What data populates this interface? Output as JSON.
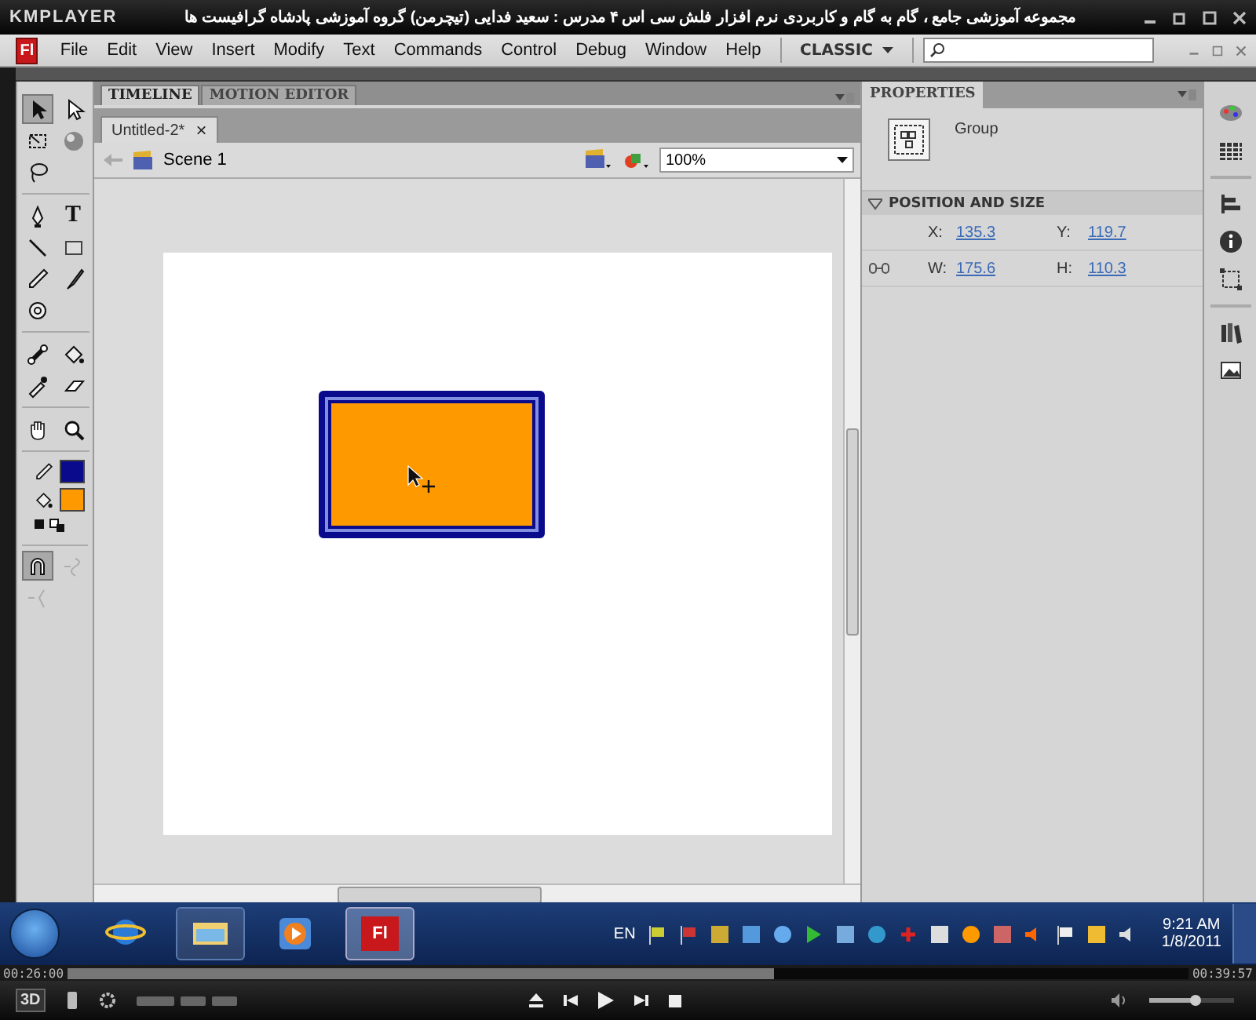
{
  "player": {
    "logo": "KMPLAYER",
    "title": "مجموعه آموزشی جامع ، گام به گام و کاربردی نرم افزار فلش سی اس ۴  مدرس : سعید فدایی (تیچرمن) گروه آموزشی پادشاه گرافیست ها"
  },
  "app": {
    "logo": "Fl",
    "menus": [
      "File",
      "Edit",
      "View",
      "Insert",
      "Modify",
      "Text",
      "Commands",
      "Control",
      "Debug",
      "Window",
      "Help"
    ],
    "workspace": "CLASSIC"
  },
  "panel_tabs": [
    {
      "label": "TIMELINE",
      "selected": true
    },
    {
      "label": "MOTION EDITOR",
      "selected": false
    }
  ],
  "document_tabs": [
    {
      "label": "Untitled-2*",
      "close": "×",
      "selected": true
    }
  ],
  "breadcrumb": "Scene 1",
  "zoom": "100%",
  "tools": [
    {
      "kind": "selection",
      "selected": true
    },
    {
      "kind": "subselection",
      "selected": false
    },
    {
      "kind": "transform",
      "selected": false
    },
    {
      "kind": "rotate3d",
      "selected": false
    },
    {
      "kind": "lasso",
      "selected": false
    },
    {
      "kind": "pen",
      "selected": false
    },
    {
      "kind": "text",
      "label": "T",
      "selected": false
    },
    {
      "kind": "line",
      "selected": false
    },
    {
      "kind": "rectangle",
      "selected": false
    },
    {
      "kind": "pencil",
      "selected": false
    },
    {
      "kind": "brush",
      "selected": false
    },
    {
      "kind": "deco",
      "selected": false
    },
    {
      "kind": "bone",
      "selected": false
    },
    {
      "kind": "bucket",
      "selected": false
    },
    {
      "kind": "eyedropper",
      "selected": false
    },
    {
      "kind": "eraser",
      "selected": false
    },
    {
      "kind": "hand",
      "selected": false
    },
    {
      "kind": "zoom",
      "selected": false
    }
  ],
  "colors": [
    {
      "kind": "stroke",
      "color": "#0a0a8c"
    },
    {
      "kind": "fill",
      "color": "#ff9900"
    }
  ],
  "options": [
    {
      "kind": "snap",
      "selected": true,
      "disabled": false
    },
    {
      "kind": "smooth",
      "selected": false,
      "disabled": true
    },
    {
      "kind": "straighten",
      "selected": false,
      "disabled": true
    }
  ],
  "properties": {
    "title": "PROPERTIES",
    "object_type": "Group",
    "section": {
      "title": "POSITION AND SIZE",
      "expanded": true,
      "fields": [
        {
          "label": "X:",
          "value": "135.3"
        },
        {
          "label": "Y:",
          "value": "119.7"
        },
        {
          "label": "W:",
          "value": "175.6"
        },
        {
          "label": "H:",
          "value": "110.3"
        }
      ]
    }
  },
  "taskbar": {
    "apps": [
      {
        "kind": "browser",
        "running": false,
        "selected": false
      },
      {
        "kind": "folder",
        "running": true,
        "selected": false
      },
      {
        "kind": "media",
        "running": false,
        "selected": false
      },
      {
        "kind": "flash",
        "label": "Fl",
        "running": true,
        "selected": true
      }
    ],
    "language": "EN",
    "time": "9:21 AM",
    "date": "1/8/2011"
  },
  "playback": {
    "elapsed": "00:26:00",
    "total": "00:39:57",
    "level": 0.63,
    "badge": "3D",
    "volume": {
      "level": 0.55
    }
  }
}
